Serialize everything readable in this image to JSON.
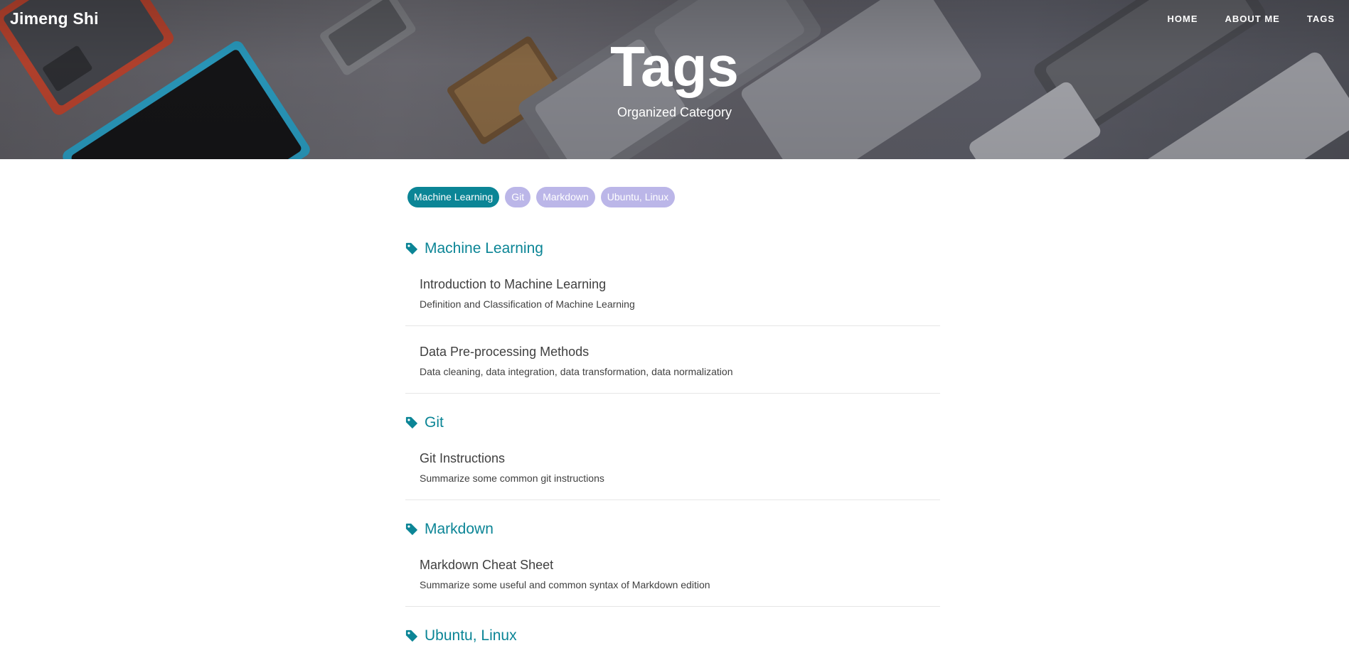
{
  "site": {
    "brand": "Jimeng Shi",
    "nav": [
      {
        "label": "HOME"
      },
      {
        "label": "ABOUT ME"
      },
      {
        "label": "TAGS"
      }
    ]
  },
  "hero": {
    "title": "Tags",
    "subtitle": "Organized Category"
  },
  "tag_cloud": [
    {
      "label": "Machine Learning",
      "active": true
    },
    {
      "label": "Git",
      "active": false
    },
    {
      "label": "Markdown",
      "active": false
    },
    {
      "label": "Ubuntu, Linux",
      "active": false
    }
  ],
  "sections": [
    {
      "tag": "Machine Learning",
      "posts": [
        {
          "title": "Introduction to Machine Learning",
          "subtitle": "Definition and Classification of Machine Learning"
        },
        {
          "title": "Data Pre-processing Methods",
          "subtitle": "Data cleaning, data integration, data transformation, data normalization"
        }
      ]
    },
    {
      "tag": "Git",
      "posts": [
        {
          "title": "Git Instructions",
          "subtitle": "Summarize some common git instructions"
        }
      ]
    },
    {
      "tag": "Markdown",
      "posts": [
        {
          "title": "Markdown Cheat Sheet",
          "subtitle": "Summarize some useful and common syntax of Markdown edition"
        }
      ]
    },
    {
      "tag": "Ubuntu, Linux",
      "posts": []
    }
  ],
  "icons": {
    "tag": "tag-icon"
  },
  "colors": {
    "accent": "#0b8596",
    "pill_inactive": "#bbb6e8",
    "text": "#404040",
    "divider": "#e6e6e6"
  }
}
